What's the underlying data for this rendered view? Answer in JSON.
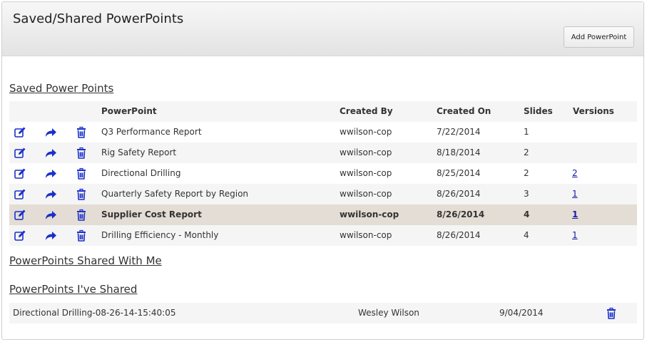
{
  "header": {
    "title": "Saved/Shared PowerPoints",
    "add_button": "Add PowerPoint"
  },
  "saved": {
    "title": "Saved Power Points",
    "columns": {
      "powerpoint": "PowerPoint",
      "created_by": "Created By",
      "created_on": "Created On",
      "slides": "Slides",
      "versions": "Versions"
    },
    "rows": [
      {
        "name": "Q3 Performance Report",
        "created_by": "wwilson-cop",
        "created_on": "7/22/2014",
        "slides": "1",
        "versions": ""
      },
      {
        "name": "Rig Safety Report",
        "created_by": "wwilson-cop",
        "created_on": "8/18/2014",
        "slides": "2",
        "versions": ""
      },
      {
        "name": "Directional Drilling",
        "created_by": "wwilson-cop",
        "created_on": "8/25/2014",
        "slides": "2",
        "versions": "2"
      },
      {
        "name": "Quarterly Safety Report by Region",
        "created_by": "wwilson-cop",
        "created_on": "8/26/2014",
        "slides": "3",
        "versions": "1"
      },
      {
        "name": "Supplier Cost Report",
        "created_by": "wwilson-cop",
        "created_on": "8/26/2014",
        "slides": "4",
        "versions": "1"
      },
      {
        "name": "Drilling Efficiency - Monthly",
        "created_by": "wwilson-cop",
        "created_on": "8/26/2014",
        "slides": "4",
        "versions": "1"
      }
    ],
    "icons": [
      "edit-icon",
      "share-icon",
      "trash-icon"
    ]
  },
  "shared_with_me": {
    "title": "PowerPoints Shared With Me"
  },
  "ive_shared": {
    "title": "PowerPoints I've Shared",
    "rows": [
      {
        "name": "Directional Drilling-08-26-14-15:40:05",
        "shared_with": "Wesley Wilson",
        "date": "9/04/2014"
      }
    ]
  },
  "colors": {
    "icon_blue": "#1a2fc9",
    "selected_row": "#e3ddd5",
    "alt_row": "#f5f5f5"
  }
}
